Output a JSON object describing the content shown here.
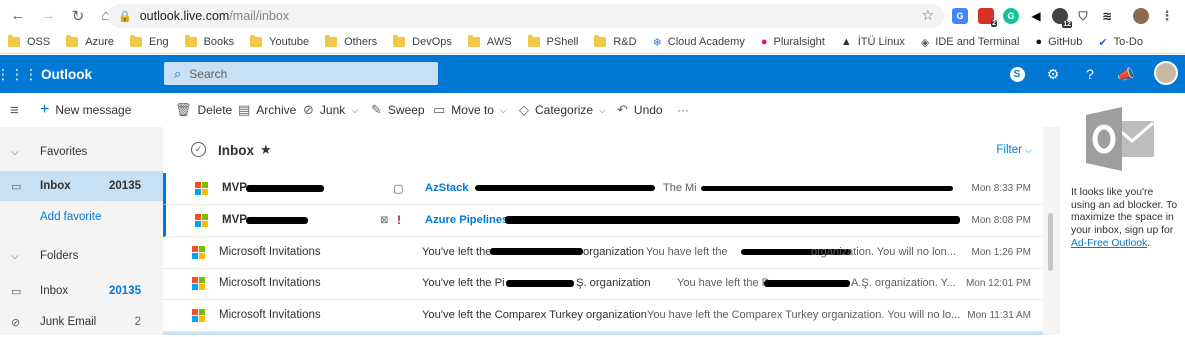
{
  "browser": {
    "url_host": "outlook.live.com",
    "url_path": "/mail/inbox",
    "badge_counts": [
      "2",
      "12"
    ],
    "bookmarks": [
      {
        "label": "OSS",
        "icon": "folder-icon"
      },
      {
        "label": "Azure",
        "icon": "folder-icon"
      },
      {
        "label": "Eng",
        "icon": "folder-icon"
      },
      {
        "label": "Books",
        "icon": "folder-icon"
      },
      {
        "label": "Youtube",
        "icon": "folder-icon"
      },
      {
        "label": "Others",
        "icon": "folder-icon"
      },
      {
        "label": "DevOps",
        "icon": "folder-icon"
      },
      {
        "label": "AWS",
        "icon": "folder-icon"
      },
      {
        "label": "PShell",
        "icon": "folder-icon"
      },
      {
        "label": "R&D",
        "icon": "folder-icon"
      },
      {
        "label": "Cloud Academy",
        "icon": "snowflake-icon"
      },
      {
        "label": "Pluralsight",
        "icon": "pluralsight-icon"
      },
      {
        "label": "İTÜ Linux",
        "icon": "tux-icon"
      },
      {
        "label": "IDE and Terminal",
        "icon": "diamond-icon"
      },
      {
        "label": "GitHub",
        "icon": "github-icon"
      },
      {
        "label": "To-Do",
        "icon": "check-icon"
      }
    ]
  },
  "outlook": {
    "brand": "Outlook",
    "search_placeholder": "Search",
    "accent": "#0078d4"
  },
  "commands": {
    "new_message": "New message",
    "delete": "Delete",
    "archive": "Archive",
    "junk": "Junk",
    "sweep": "Sweep",
    "move_to": "Move to",
    "categorize": "Categorize",
    "undo": "Undo",
    "more": "···"
  },
  "sidebar": {
    "favorites": "Favorites",
    "inbox_label": "Inbox",
    "inbox_count": "20135",
    "add_favorite": "Add favorite",
    "folders": "Folders",
    "folders_inbox_label": "Inbox",
    "folders_inbox_count": "20135",
    "junk_label": "Junk Email",
    "junk_count": "2"
  },
  "list": {
    "title": "Inbox",
    "filter": "Filter",
    "messages": [
      {
        "from": "MVP",
        "subject": "AzStack",
        "preview": "The Mi",
        "time": "Mon 8:33 PM",
        "unread": true
      },
      {
        "from": "MVP",
        "subject": "Azure Pipelines",
        "preview": "",
        "time": "Mon 8:08 PM",
        "unread": true
      },
      {
        "from": "Microsoft Invitations",
        "subject": "You've left the",
        "subject_tail": "organization",
        "preview": "You have left the",
        "preview_tail": "organization. You will no lon...",
        "time": "Mon 1:26 PM",
        "unread": false
      },
      {
        "from": "Microsoft Invitations",
        "subject": "You've left the Pi",
        "subject_tail": "Ş. organization",
        "preview": "You have left the P",
        "preview_tail": "A.Ş. organization. Y...",
        "time": "Mon 12:01 PM",
        "unread": false
      },
      {
        "from": "Microsoft Invitations",
        "subject": "You've left the Comparex Turkey organization",
        "subject_tail": "",
        "preview": "You have left the Comparex Turkey organization. You will no lo...",
        "preview_tail": "",
        "time": "Mon 11:31 AM",
        "unread": false
      }
    ]
  },
  "ad": {
    "line1": "It looks like you're using an ad blocker. To maximize the space in your inbox, sign up for",
    "link": "Ad-Free Outlook",
    "tail": "."
  }
}
